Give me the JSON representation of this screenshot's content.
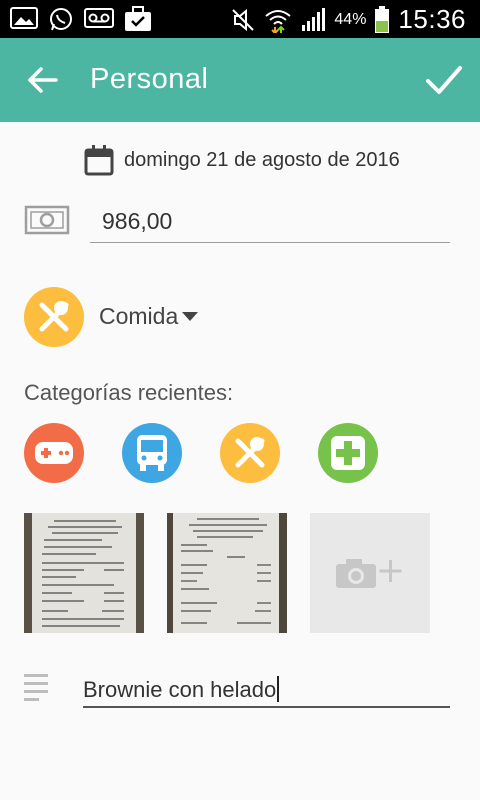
{
  "status_bar": {
    "battery_percent": "44%",
    "time": "15:36",
    "icons": [
      "image-icon",
      "whatsapp-icon",
      "voicemail-icon",
      "briefcase-check-icon",
      "mute-icon",
      "wifi-icon",
      "signal-icon",
      "battery-icon"
    ]
  },
  "app_bar": {
    "title": "Personal",
    "back_icon": "arrow-left-icon",
    "confirm_icon": "check-icon",
    "color": "#4db6a2"
  },
  "form": {
    "date": "domingo 21 de agosto de 2016",
    "amount": "986,00",
    "category": {
      "label": "Comida",
      "icon": "fork-spoon-icon",
      "color": "#fdbe40"
    },
    "recent_categories_label": "Categorías recientes:",
    "recent_categories": [
      {
        "icon": "gamepad-icon",
        "color": "#f26d47"
      },
      {
        "icon": "bus-icon",
        "color": "#3ea6e3"
      },
      {
        "icon": "fork-spoon-icon",
        "color": "#fdbe40"
      },
      {
        "icon": "medical-cross-icon",
        "color": "#76c24a"
      }
    ],
    "photos": [
      "receipt-photo-1",
      "receipt-photo-2"
    ],
    "add_photo_icon": "camera-plus-icon",
    "note": "Brownie con helado"
  }
}
